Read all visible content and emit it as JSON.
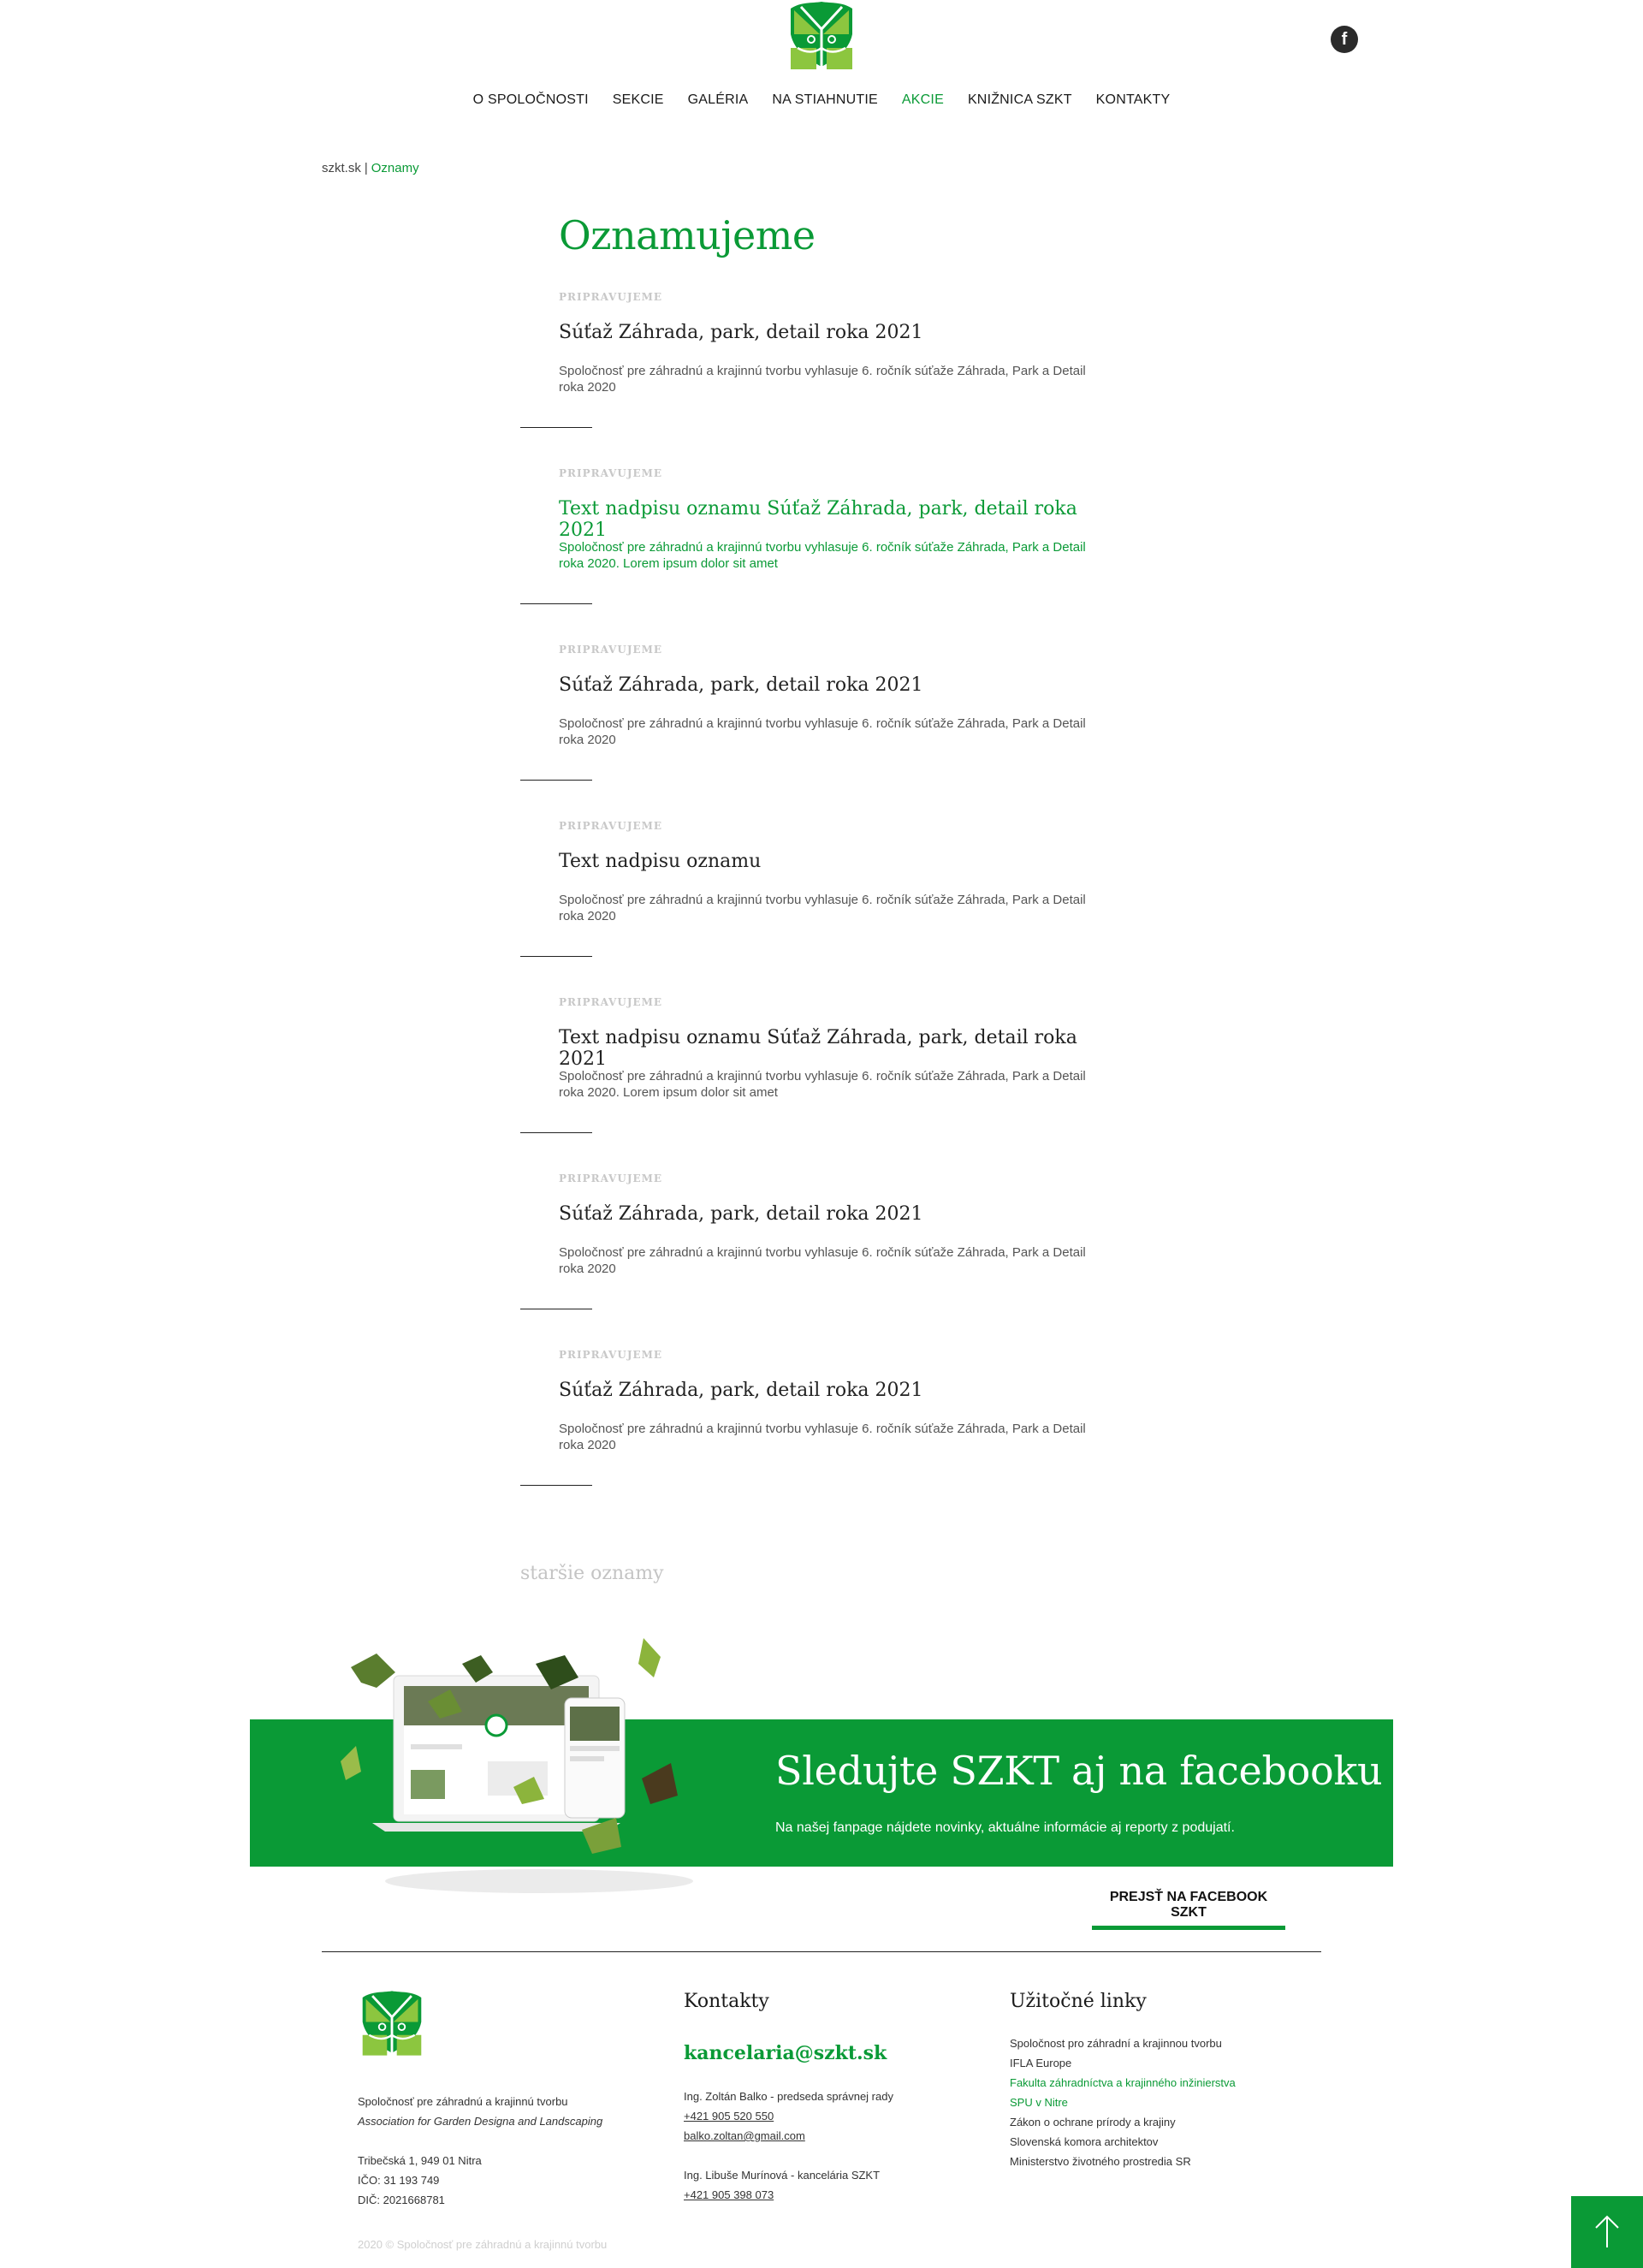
{
  "header": {
    "logo_alt": "SZKT",
    "facebook_icon": "f",
    "nav": [
      {
        "label": "O SPOLOČNOSTI",
        "active": false
      },
      {
        "label": "SEKCIE",
        "active": false
      },
      {
        "label": "GALÉRIA",
        "active": false
      },
      {
        "label": "NA STIAHNUTIE",
        "active": false
      },
      {
        "label": "AKCIE",
        "active": true
      },
      {
        "label": "KNIŽNICA SZKT",
        "active": false
      },
      {
        "label": "KONTAKTY",
        "active": false
      }
    ]
  },
  "breadcrumb": {
    "home": "szkt.sk",
    "separator": "|",
    "current": "Oznamy"
  },
  "page_title": "Oznamujeme",
  "announcements": [
    {
      "category": "PRIPRAVUJEME",
      "title": "Súťaž Záhrada, park, detail  roka 2021",
      "desc": "Spoločnosť pre záhradnú a krajinnú tvorbu vyhlasuje 6. ročník súťaže Záhrada, Park a Detail roka 2020",
      "highlighted": false
    },
    {
      "category": "PRIPRAVUJEME",
      "title": "Text nadpisu oznamu Súťaž Záhrada, park, detail  roka 2021",
      "desc": "Spoločnosť pre záhradnú a krajinnú tvorbu vyhlasuje 6. ročník súťaže Záhrada, Park a Detail roka 2020. Lorem ipsum dolor sit amet",
      "highlighted": true
    },
    {
      "category": "PRIPRAVUJEME",
      "title": "Súťaž Záhrada, park, detail  roka 2021",
      "desc": "Spoločnosť pre záhradnú a krajinnú tvorbu vyhlasuje 6. ročník súťaže Záhrada, Park a Detail roka 2020",
      "highlighted": false
    },
    {
      "category": "PRIPRAVUJEME",
      "title": "Text nadpisu oznamu",
      "desc": "Spoločnosť pre záhradnú a krajinnú tvorbu vyhlasuje 6. ročník súťaže Záhrada, Park a Detail roka 2020",
      "highlighted": false
    },
    {
      "category": "PRIPRAVUJEME",
      "title": "Text nadpisu oznamu Súťaž Záhrada, park, detail  roka 2021",
      "desc": "Spoločnosť pre záhradnú a krajinnú tvorbu vyhlasuje 6. ročník súťaže Záhrada, Park a Detail roka 2020. Lorem ipsum dolor sit amet",
      "highlighted": false
    },
    {
      "category": "PRIPRAVUJEME",
      "title": "Súťaž Záhrada, park, detail  roka 2021",
      "desc": "Spoločnosť pre záhradnú a krajinnú tvorbu vyhlasuje 6. ročník súťaže Záhrada, Park a Detail roka 2020",
      "highlighted": false
    },
    {
      "category": "PRIPRAVUJEME",
      "title": "Súťaž Záhrada, park, detail  roka 2021",
      "desc": "Spoločnosť pre záhradnú a krajinnú tvorbu vyhlasuje 6. ročník súťaže Záhrada, Park a Detail roka 2020",
      "highlighted": false
    }
  ],
  "older_link": "staršie oznamy",
  "facebook_promo": {
    "title": "Sledujte SZKT aj na facebooku",
    "subtitle": "Na našej fanpage nájdete novinky, aktuálne informácie aj reporty z podujatí.",
    "cta": "PREJSŤ NA FACEBOOK SZKT"
  },
  "footer": {
    "org_name": "Spoločnosť pre záhradnú a krajinnú tvorbu",
    "org_name_en": "Association for Garden Designa and Landscaping",
    "address": "Tribečská 1,  949 01 Nitra",
    "ico": "IČO: 31 193 749",
    "dic": "DIČ: 2021668781",
    "copyright": "2020 © Spoločnosť pre záhradnú a krajinnú tvorbu",
    "contacts_title": "Kontakty",
    "email": "kancelaria@szkt.sk",
    "contact1_name": "Ing. Zoltán Balko - predseda správnej rady",
    "contact1_phone": "+421 905 520 550 ",
    "contact1_email": "balko.zoltan@gmail.com ",
    "contact2_name": "Ing. Libuše Murínová - kancelária SZKT",
    "contact2_phone": "+421 905 398 073",
    "links_title": "Užitočné linky",
    "links": [
      {
        "label": "Spoločnost pro záhradní a krajinnou tvorbu",
        "green": false
      },
      {
        "label": "IFLA Europe",
        "green": false
      },
      {
        "label": "Fakulta záhradníctva a krajinného inžinierstva",
        "green": true
      },
      {
        "label": "SPU v Nitre",
        "green": true
      },
      {
        "label": "Zákon o ochrane prírody a krajiny",
        "green": false
      },
      {
        "label": "Slovenská komora architektov",
        "green": false
      },
      {
        "label": "Ministerstvo životného prostredia SR",
        "green": false
      }
    ]
  },
  "colors": {
    "brand_green": "#0a9a36",
    "light_green": "#8cc63f",
    "text": "#2a2a2a"
  },
  "icons": {
    "facebook": "facebook-icon",
    "back_to_top": "arrow-up-icon",
    "logo": "szkt-leaf-logo"
  }
}
